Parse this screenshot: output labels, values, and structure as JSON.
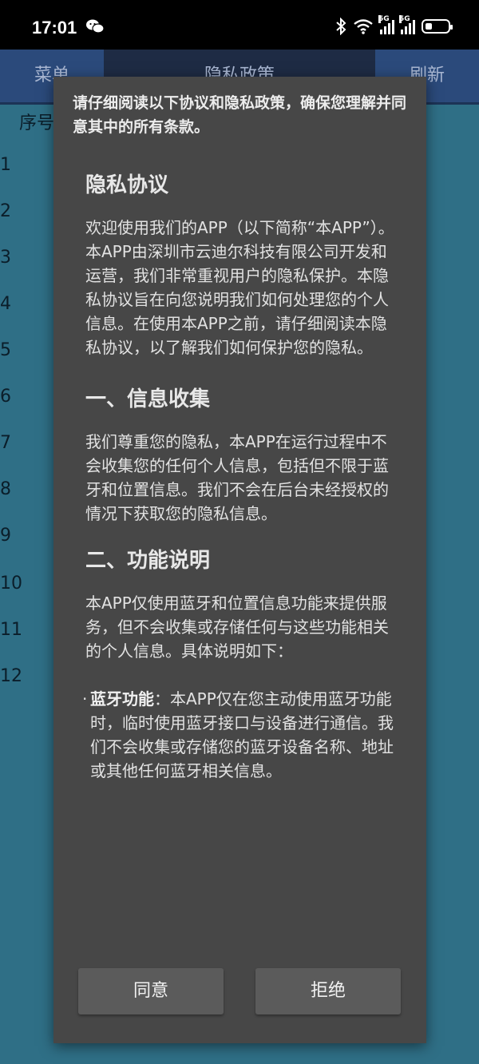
{
  "status_bar": {
    "time": "17:01",
    "signal_tag_1": "5G",
    "signal_tag_2": "5G",
    "wifi_tag": "6"
  },
  "background_app": {
    "tabs": [
      "菜单",
      "隐私政策",
      "刷新"
    ],
    "column_header": "序号",
    "row_numbers": [
      "1",
      "2",
      "3",
      "4",
      "5",
      "6",
      "7",
      "8",
      "9",
      "10",
      "11",
      "12"
    ]
  },
  "dialog": {
    "header_text": "请仔细阅读以下协议和隐私政策，确保您理解并同意其中的所有条款。",
    "title": "隐私协议",
    "intro": "欢迎使用我们的APP（以下简称“本APP”）。本APP由深圳市云迪尔科技有限公司开发和运营，我们非常重视用户的隐私保护。本隐私协议旨在向您说明我们如何处理您的个人信息。在使用本APP之前，请仔细阅读本隐私协议，以了解我们如何保护您的隐私。",
    "section1_title": "一、信息收集",
    "section1_body": "我们尊重您的隐私，本APP在运行过程中不会收集您的任何个人信息，包括但不限于蓝牙和位置信息。我们不会在后台未经授权的情况下获取您的隐私信息。",
    "section2_title": "二、功能说明",
    "section2_body": "本APP仅使用蓝牙和位置信息功能来提供服务，但不会收集或存储任何与这些功能相关的个人信息。具体说明如下：",
    "bullet_label": "蓝牙功能",
    "bullet_text": "：本APP仅在您主动使用蓝牙功能时，临时使用蓝牙接口与设备进行通信。我们不会收集或存储您的蓝牙设备名称、地址或其他任何蓝牙相关信息。",
    "agree_label": "同意",
    "reject_label": "拒绝"
  }
}
